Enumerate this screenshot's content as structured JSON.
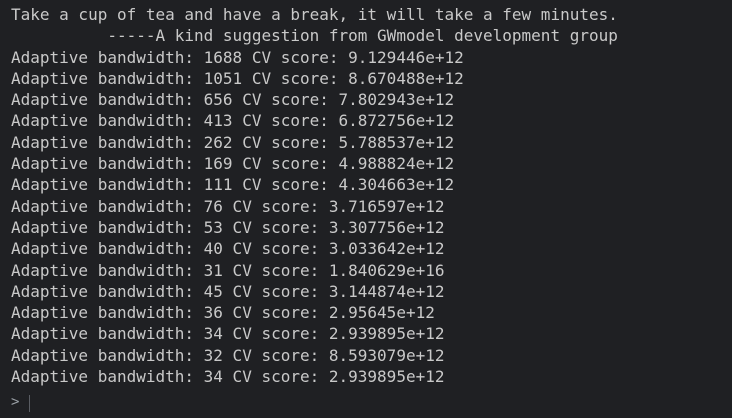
{
  "console": {
    "lines": [
      "Take a cup of tea and have a break, it will take a few minutes.",
      "          -----A kind suggestion from GWmodel development group",
      "Adaptive bandwidth: 1688 CV score: 9.129446e+12",
      "Adaptive bandwidth: 1051 CV score: 8.670488e+12",
      "Adaptive bandwidth: 656 CV score: 7.802943e+12",
      "Adaptive bandwidth: 413 CV score: 6.872756e+12",
      "Adaptive bandwidth: 262 CV score: 5.788537e+12",
      "Adaptive bandwidth: 169 CV score: 4.988824e+12",
      "Adaptive bandwidth: 111 CV score: 4.304663e+12",
      "Adaptive bandwidth: 76 CV score: 3.716597e+12",
      "Adaptive bandwidth: 53 CV score: 3.307756e+12",
      "Adaptive bandwidth: 40 CV score: 3.033642e+12",
      "Adaptive bandwidth: 31 CV score: 1.840629e+16",
      "Adaptive bandwidth: 45 CV score: 3.144874e+12",
      "Adaptive bandwidth: 36 CV score: 2.95645e+12",
      "Adaptive bandwidth: 34 CV score: 2.939895e+12",
      "Adaptive bandwidth: 32 CV score: 8.593079e+12",
      "Adaptive bandwidth: 34 CV score: 2.939895e+12"
    ],
    "prompt": ">"
  },
  "colors": {
    "background": "#1f2023",
    "text": "#c9c9c9",
    "prompt": "#9aa0a6",
    "cursor": "#5a5d63"
  }
}
